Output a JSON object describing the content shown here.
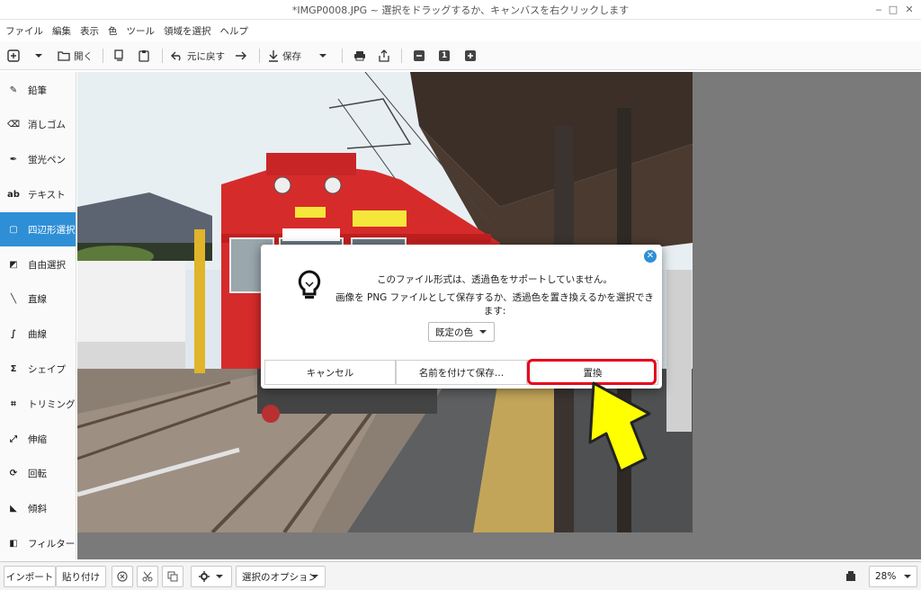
{
  "window": {
    "title": "*IMGP0008.JPG ~ 選択をドラッグするか、キャンバスを右クリックします"
  },
  "menu": [
    "ファイル",
    "編集",
    "表示",
    "色",
    "ツール",
    "領域を選択",
    "ヘルプ"
  ],
  "toolbar": {
    "open_label": "開く",
    "undo_label": "元に戻す",
    "save_label": "保存",
    "zoom_value": "1"
  },
  "tools": [
    {
      "label": "鉛筆",
      "icon": "pencil-icon",
      "glyph": "✎"
    },
    {
      "label": "消しゴム",
      "icon": "eraser-icon",
      "glyph": "⌫"
    },
    {
      "label": "蛍光ペン",
      "icon": "highlighter-icon",
      "glyph": "✒"
    },
    {
      "label": "テキスト",
      "icon": "text-icon",
      "glyph": "ab"
    },
    {
      "label": "四辺形選択",
      "icon": "rect-select-icon",
      "glyph": "▢"
    },
    {
      "label": "自由選択",
      "icon": "free-select-icon",
      "glyph": "◩"
    },
    {
      "label": "直線",
      "icon": "line-icon",
      "glyph": "╲"
    },
    {
      "label": "曲線",
      "icon": "curve-icon",
      "glyph": "∫"
    },
    {
      "label": "シェイプ",
      "icon": "shape-icon",
      "glyph": "Σ"
    },
    {
      "label": "トリミング",
      "icon": "crop-icon",
      "glyph": "⌗"
    },
    {
      "label": "伸縮",
      "icon": "scale-icon",
      "glyph": "⤢"
    },
    {
      "label": "回転",
      "icon": "rotate-icon",
      "glyph": "⟳"
    },
    {
      "label": "傾斜",
      "icon": "skew-icon",
      "glyph": "◣"
    },
    {
      "label": "フィルター",
      "icon": "filter-icon",
      "glyph": "◧"
    }
  ],
  "active_tool": 4,
  "dialog": {
    "line1": "このファイル形式は、透過色をサポートしていません。",
    "line2": "画像を PNG ファイルとして保存するか、透過色を置き換えるかを選択できます:",
    "select_value": "既定の色",
    "cancel_label": "キャンセル",
    "save_as_label": "名前を付けて保存…",
    "replace_label": "置換"
  },
  "statusbar": {
    "import_label": "インポート",
    "paste_label": "貼り付け",
    "selection_options_label": "選択のオプション",
    "zoom_label": "28%"
  },
  "colors": {
    "accent": "#2f8fd6",
    "highlight": "#e8001a",
    "arrow_fill": "#ffff00"
  }
}
